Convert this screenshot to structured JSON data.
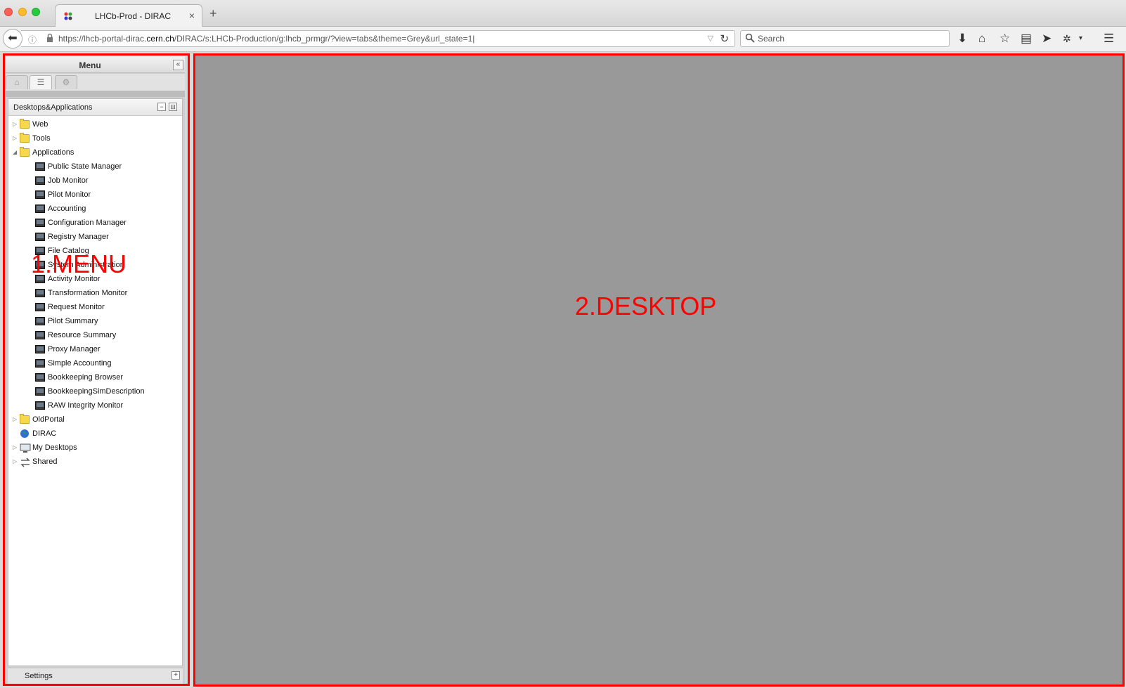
{
  "browser": {
    "tab_title": "LHCb-Prod - DIRAC",
    "tab_close": "×",
    "new_tab": "+",
    "url_prefix": "https://lhcb-portal-dirac.",
    "url_domain": "cern.ch",
    "url_suffix": "/DIRAC/s:LHCb-Production/g:lhcb_prmgr/?view=tabs&theme=Grey&url_state=1|",
    "search_placeholder": "Search"
  },
  "menu": {
    "title": "Menu",
    "collapse_glyph": "«",
    "tree_title": "Desktops&Applications",
    "items": [
      {
        "label": "Web",
        "type": "folder",
        "level": 0,
        "expandable": true,
        "expanded": false
      },
      {
        "label": "Tools",
        "type": "folder",
        "level": 0,
        "expandable": true,
        "expanded": false
      },
      {
        "label": "Applications",
        "type": "folder-open",
        "level": 0,
        "expandable": true,
        "expanded": true
      },
      {
        "label": "Public State Manager",
        "type": "app",
        "level": 1
      },
      {
        "label": "Job Monitor",
        "type": "app",
        "level": 1
      },
      {
        "label": "Pilot Monitor",
        "type": "app",
        "level": 1
      },
      {
        "label": "Accounting",
        "type": "app",
        "level": 1
      },
      {
        "label": "Configuration Manager",
        "type": "app",
        "level": 1
      },
      {
        "label": "Registry Manager",
        "type": "app",
        "level": 1
      },
      {
        "label": "File Catalog",
        "type": "app",
        "level": 1
      },
      {
        "label": "System Administration",
        "type": "app",
        "level": 1
      },
      {
        "label": "Activity Monitor",
        "type": "app",
        "level": 1
      },
      {
        "label": "Transformation Monitor",
        "type": "app",
        "level": 1
      },
      {
        "label": "Request Monitor",
        "type": "app",
        "level": 1
      },
      {
        "label": "Pilot Summary",
        "type": "app",
        "level": 1
      },
      {
        "label": "Resource Summary",
        "type": "app",
        "level": 1
      },
      {
        "label": "Proxy Manager",
        "type": "app",
        "level": 1
      },
      {
        "label": "Simple Accounting",
        "type": "app",
        "level": 1
      },
      {
        "label": "Bookkeeping Browser",
        "type": "app",
        "level": 1
      },
      {
        "label": "BookkeepingSimDescription",
        "type": "app",
        "level": 1
      },
      {
        "label": "RAW Integrity Monitor",
        "type": "app",
        "level": 1
      },
      {
        "label": "OldPortal",
        "type": "folder",
        "level": 0,
        "expandable": true,
        "expanded": false
      },
      {
        "label": "DIRAC",
        "type": "globe",
        "level": 0,
        "expandable": false
      },
      {
        "label": "My Desktops",
        "type": "desktop",
        "level": 0,
        "expandable": true,
        "expanded": false
      },
      {
        "label": "Shared",
        "type": "shared",
        "level": 0,
        "expandable": true,
        "expanded": false
      }
    ],
    "settings_label": "Settings"
  },
  "annotations": {
    "menu_label": "1.MENU",
    "desktop_label": "2.DESKTOP",
    "frame_color": "#ff0000"
  },
  "colors": {
    "desktop_bg": "#999999",
    "panel_bg": "#cfcfcf"
  }
}
